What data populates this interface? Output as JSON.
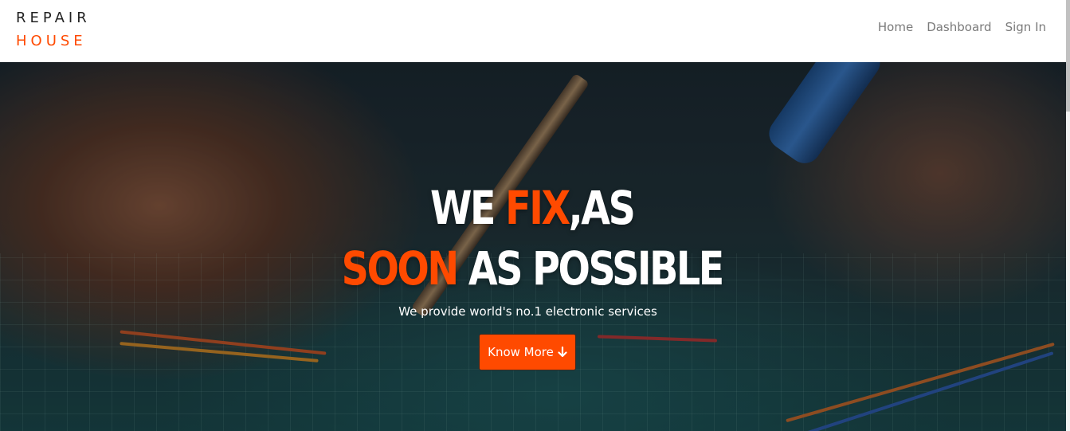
{
  "brand": {
    "line1": "REPAIR",
    "line2": "HOUSE"
  },
  "nav": {
    "items": [
      {
        "label": "Home"
      },
      {
        "label": "Dashboard"
      },
      {
        "label": "Sign In"
      }
    ]
  },
  "hero": {
    "headline_line1": {
      "white1": "WE ",
      "accent": "FIX",
      "white2": ",AS"
    },
    "headline_line2": {
      "accent": "SOON",
      "white": " AS POSSIBLE"
    },
    "subtitle": "We provide world's no.1 electronic services",
    "cta_label": "Know More",
    "cta_icon": "arrow-down-icon"
  },
  "colors": {
    "accent": "#ff4a00",
    "nav_text": "#7a7a7a",
    "brand_dark": "#222222"
  }
}
